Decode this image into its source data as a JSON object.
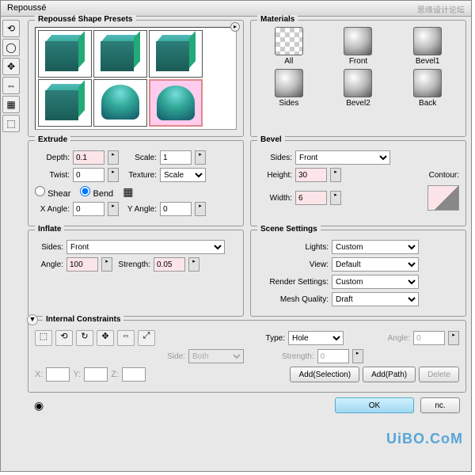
{
  "title": "Repoussé",
  "watermark": "思缘设计论坛",
  "watermark2": "UiBO.CoM",
  "presets": {
    "legend": "Repoussé Shape Presets"
  },
  "materials": {
    "legend": "Materials",
    "items": [
      "All",
      "Front",
      "Bevel1",
      "Sides",
      "Bevel2",
      "Back"
    ]
  },
  "extrude": {
    "legend": "Extrude",
    "depth_label": "Depth:",
    "depth": "0.1",
    "scale_label": "Scale:",
    "scale": "1",
    "twist_label": "Twist:",
    "twist": "0",
    "texture_label": "Texture:",
    "texture": "Scale",
    "shear": "Shear",
    "bend": "Bend",
    "xangle_label": "X Angle:",
    "xangle": "0",
    "yangle_label": "Y Angle:",
    "yangle": "0"
  },
  "bevel": {
    "legend": "Bevel",
    "sides_label": "Sides:",
    "sides": "Front",
    "height_label": "Height:",
    "height": "30",
    "width_label": "Width:",
    "width": "6",
    "contour_label": "Contour:"
  },
  "inflate": {
    "legend": "Inflate",
    "sides_label": "Sides:",
    "sides": "Front",
    "angle_label": "Angle:",
    "angle": "100",
    "strength_label": "Strength:",
    "strength": "0.05"
  },
  "scene": {
    "legend": "Scene Settings",
    "lights_label": "Lights:",
    "lights": "Custom",
    "view_label": "View:",
    "view": "Default",
    "render_label": "Render Settings:",
    "render": "Custom",
    "mesh_label": "Mesh Quality:",
    "mesh": "Draft"
  },
  "constraints": {
    "legend": "Internal Constraints",
    "type_label": "Type:",
    "type": "Hole",
    "side_label": "Side:",
    "side": "Both",
    "angle_label": "Angle:",
    "angle": "0",
    "strength_label": "Strength:",
    "strength": "0",
    "add_sel": "Add(Selection)",
    "add_path": "Add(Path)",
    "delete": "Delete",
    "x": "X:",
    "y": "Y:",
    "z": "Z:"
  },
  "buttons": {
    "ok": "OK",
    "nc": "nc."
  }
}
